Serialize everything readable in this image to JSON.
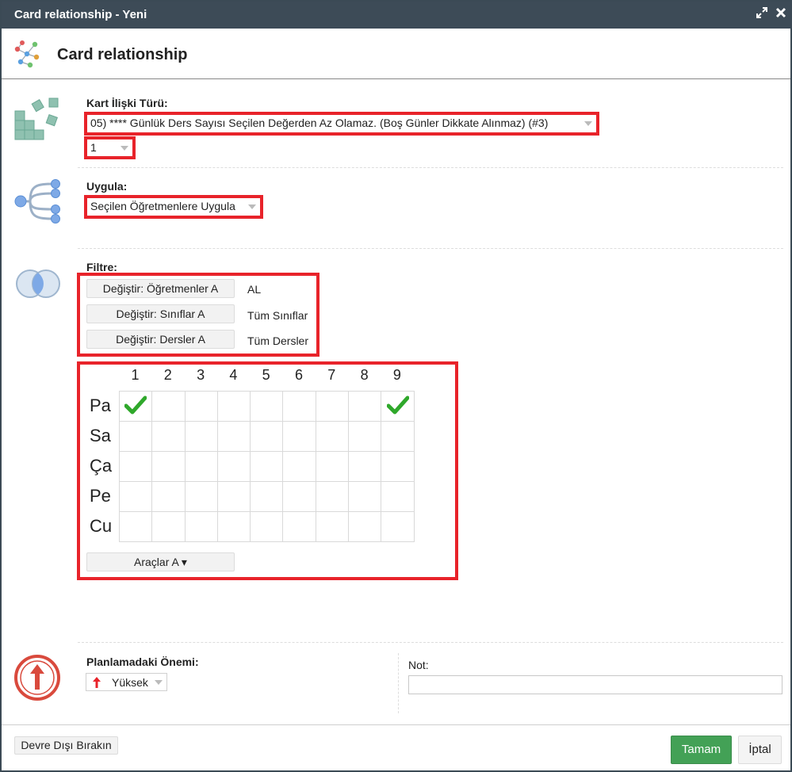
{
  "window": {
    "title": "Card relationship - Yeni"
  },
  "header": {
    "title": "Card relationship"
  },
  "type_section": {
    "label": "Kart İlişki Türü:",
    "type_value": "05) **** Günlük Ders Sayısı Seçilen Değerden Az Olamaz. (Boş Günler Dikkate Alınmaz) (#3)",
    "count_value": "1"
  },
  "apply_section": {
    "label": "Uygula:",
    "value": "Seçilen Öğretmenlere Uygula"
  },
  "filter_section": {
    "label": "Filtre:",
    "rows": [
      {
        "button": "Değiştir: Öğretmenler A",
        "value": "AL"
      },
      {
        "button": "Değiştir: Sınıflar A",
        "value": "Tüm Sınıflar"
      },
      {
        "button": "Değiştir: Dersler A",
        "value": "Tüm Dersler"
      }
    ]
  },
  "grid": {
    "columns": [
      "1",
      "2",
      "3",
      "4",
      "5",
      "6",
      "7",
      "8",
      "9"
    ],
    "rows": [
      "Pa",
      "Sa",
      "Ça",
      "Pe",
      "Cu"
    ],
    "checked": [
      [
        0,
        0
      ],
      [
        0,
        8
      ]
    ],
    "tools_button": "Araçlar A ▾"
  },
  "importance": {
    "label": "Planlamadaki Önemi:",
    "value": "Yüksek",
    "note_label": "Not:",
    "note_value": ""
  },
  "footer": {
    "disable_button": "Devre Dışı Bırakın",
    "ok_button": "Tamam",
    "cancel_button": "İptal"
  },
  "colors": {
    "titlebar": "#3d4b57",
    "highlight": "#e8232a",
    "ok": "#43a156",
    "check": "#2fa82b"
  }
}
